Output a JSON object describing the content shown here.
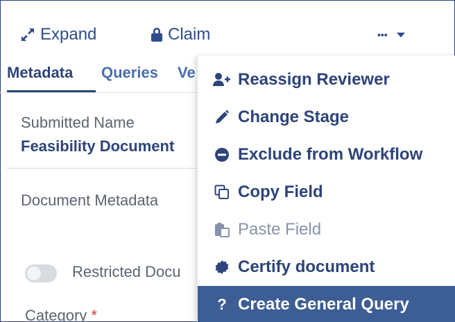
{
  "toolbar": {
    "expand_label": "Expand",
    "claim_label": "Claim",
    "more_label": "•••"
  },
  "tabs": [
    {
      "label": "Metadata",
      "active": true
    },
    {
      "label": "Queries",
      "active": false
    },
    {
      "label": "Ve",
      "active": false
    }
  ],
  "fields": {
    "submitted_name_label": "Submitted Name",
    "submitted_name_value": "Feasibility Document",
    "document_metadata_label": "Document Metadata",
    "restricted_label": "Restricted Docu",
    "category_label": "Category",
    "required_mark": "*"
  },
  "menu": {
    "items": [
      {
        "label": "Reassign Reviewer",
        "icon": "user-plus-icon",
        "state": "enabled"
      },
      {
        "label": "Change Stage",
        "icon": "pencil-icon",
        "state": "enabled"
      },
      {
        "label": "Exclude from Workflow",
        "icon": "minus-circle-icon",
        "state": "enabled"
      },
      {
        "label": "Copy Field",
        "icon": "copy-icon",
        "state": "enabled"
      },
      {
        "label": "Paste Field",
        "icon": "paste-icon",
        "state": "disabled"
      },
      {
        "label": "Certify document",
        "icon": "certificate-icon",
        "state": "enabled"
      },
      {
        "label": "Create General Query",
        "icon": "question-icon",
        "state": "highlighted"
      }
    ]
  },
  "colors": {
    "primary": "#2d4479",
    "link": "#2f4d8c",
    "highlight_bg": "#3d5e95",
    "disabled": "#8792ab",
    "required": "#d43a3a"
  }
}
